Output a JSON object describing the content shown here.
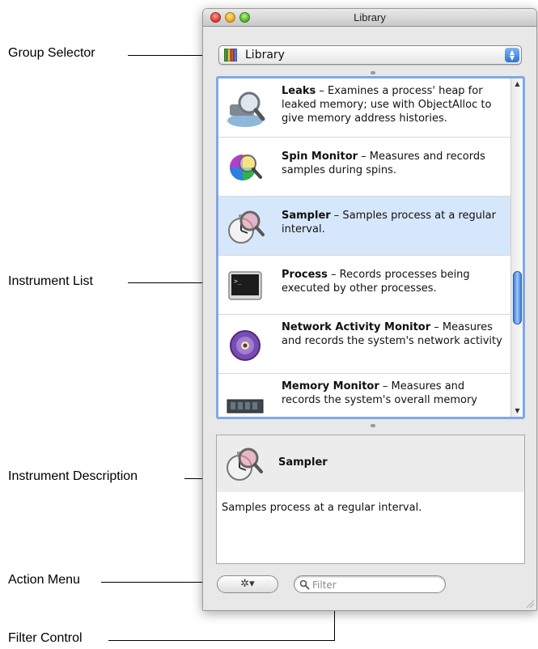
{
  "callouts": {
    "group_selector": "Group Selector",
    "instrument_list": "Instrument List",
    "instrument_description": "Instrument Description",
    "action_menu": "Action Menu",
    "filter_control": "Filter Control"
  },
  "window": {
    "title": "Library"
  },
  "group_selector": {
    "selected": "Library",
    "icon": "colored-books-icon"
  },
  "instruments": [
    {
      "name": "Leaks",
      "description": " – Examines a process' heap for leaked memory; use with ObjectAlloc to give memory address histories.",
      "icon": "leaks-icon",
      "selected": false
    },
    {
      "name": "Spin Monitor",
      "description": "  – Measures and records samples during spins.",
      "icon": "spin-monitor-icon",
      "selected": false
    },
    {
      "name": "Sampler",
      "description": "  – Samples process at a regular interval.",
      "icon": "sampler-icon",
      "selected": true
    },
    {
      "name": "Process",
      "description": " – Records processes being executed by other processes.",
      "icon": "terminal-icon",
      "selected": false
    },
    {
      "name": "Network Activity Monitor",
      "description": " – Measures and records the system's network activity",
      "icon": "network-icon",
      "selected": false
    },
    {
      "name": "Memory Monitor",
      "description": " – Measures and records the system's overall memory",
      "icon": "memory-icon",
      "selected": false
    }
  ],
  "description_pane": {
    "title": "Sampler",
    "body": "Samples process at a regular interval.",
    "icon": "sampler-icon"
  },
  "action_menu": {
    "icon": "gear-icon",
    "glyph": "✲▾"
  },
  "filter": {
    "placeholder": "Filter",
    "icon": "search-icon"
  },
  "colors": {
    "selection": "#d7e7fb",
    "focus_ring": "#7fa9e6",
    "scroll_thumb": "#3f7fd8"
  }
}
